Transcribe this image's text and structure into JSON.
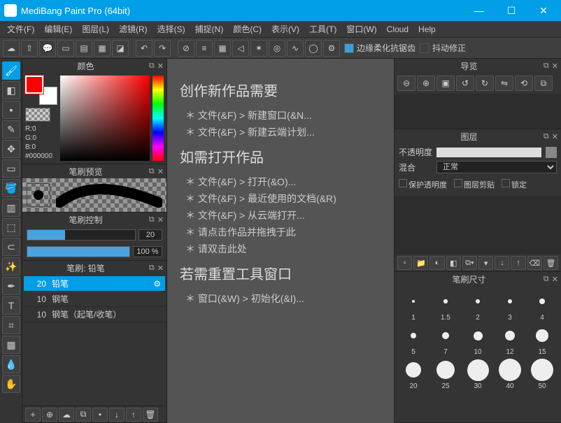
{
  "title": "MediBang Paint Pro (64bit)",
  "menus": [
    "文件(F)",
    "编辑(E)",
    "图层(L)",
    "滤镜(R)",
    "选择(S)",
    "捕捉(N)",
    "颜色(C)",
    "表示(V)",
    "工具(T)",
    "窗口(W)",
    "Cloud",
    "Help"
  ],
  "toolbar_right": {
    "antialias": "边缘柔化抗锯齿",
    "stabilize": "抖动修正"
  },
  "panel_color": {
    "title": "颜色",
    "r": "R:0",
    "g": "G:0",
    "b": "B:0",
    "hex": "#000000"
  },
  "panel_brush_preview": {
    "title": "笔刷预览"
  },
  "panel_brush_ctrl": {
    "title": "笔刷控制",
    "size": "20",
    "density": "100 %"
  },
  "panel_brush_list": {
    "title": "笔刷: 铅笔",
    "items": [
      {
        "size": "20",
        "name": "铅笔"
      },
      {
        "size": "10",
        "name": "钢笔"
      },
      {
        "size": "10",
        "name": "钢笔（起笔/收笔）"
      }
    ]
  },
  "canvas": {
    "h1": "创作新作品需要",
    "l1": "＊ 文件(&F)  >  新建窗口(&N...",
    "l2": "＊ 文件(&F)  >  新建云端计划...",
    "h2": "如需打开作品",
    "l3": "＊ 文件(&F)  >  打开(&O)...",
    "l4": "＊ 文件(&F)  >  最近使用的文档(&R)",
    "l5": "＊ 文件(&F)  >  从云端打开...",
    "l6": "＊ 请点击作品并拖拽于此",
    "l7": "＊ 请双击此处",
    "h3": "若需重置工具窗口",
    "l8": "＊ 窗口(&W)  >  初始化(&I)..."
  },
  "panel_nav": {
    "title": "导览"
  },
  "panel_layer": {
    "title": "图层",
    "opacity": "不透明度",
    "blend": "混合",
    "blend_val": "正常",
    "chk1": "保护透明度",
    "chk2": "图层剪贴",
    "chk3": "锁定"
  },
  "panel_brush_size": {
    "title": "笔刷尺寸",
    "sizes": [
      1,
      1.5,
      2,
      3,
      4,
      5,
      7,
      10,
      12,
      15,
      20,
      25,
      30,
      40,
      50
    ]
  }
}
